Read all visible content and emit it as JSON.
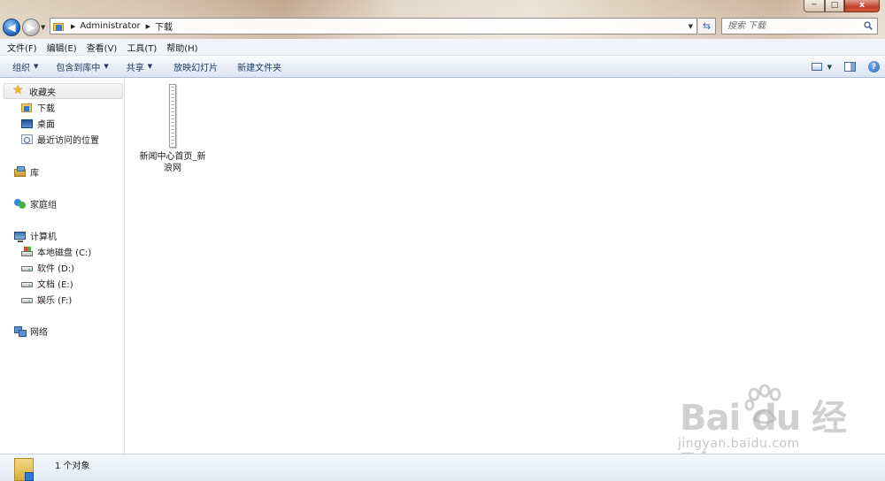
{
  "window": {
    "controls": {
      "minimize": "─",
      "maximize": "□",
      "close": "x"
    }
  },
  "address_bar": {
    "crumbs": [
      "Administrator",
      "下载"
    ],
    "search_placeholder": "搜索 下载"
  },
  "menu": [
    "文件(F)",
    "编辑(E)",
    "查看(V)",
    "工具(T)",
    "帮助(H)"
  ],
  "toolbar": {
    "organize": "组织",
    "include_in_library": "包含到库中",
    "share": "共享",
    "slideshow": "放映幻灯片",
    "new_folder": "新建文件夹",
    "help": "?"
  },
  "navigation": {
    "favorites": {
      "label": "收藏夹",
      "items": [
        "下载",
        "桌面",
        "最近访问的位置"
      ]
    },
    "libraries": "库",
    "homegroup": "家庭组",
    "computer": {
      "label": "计算机",
      "drives": [
        "本地磁盘 (C:)",
        "软件 (D:)",
        "文档 (E:)",
        "娱乐 (F:)"
      ]
    },
    "network": "网络"
  },
  "content": {
    "files": [
      {
        "name": "新闻中心首页_新浪网"
      }
    ]
  },
  "status": {
    "text": "1 个对象"
  },
  "watermark": {
    "brand": "Bai du 经验",
    "url": "jingyan.baidu.com"
  },
  "colors": {
    "accent": "#2f7bd6",
    "toolbar_text": "#1e395b",
    "selection": "#ebebeb"
  }
}
